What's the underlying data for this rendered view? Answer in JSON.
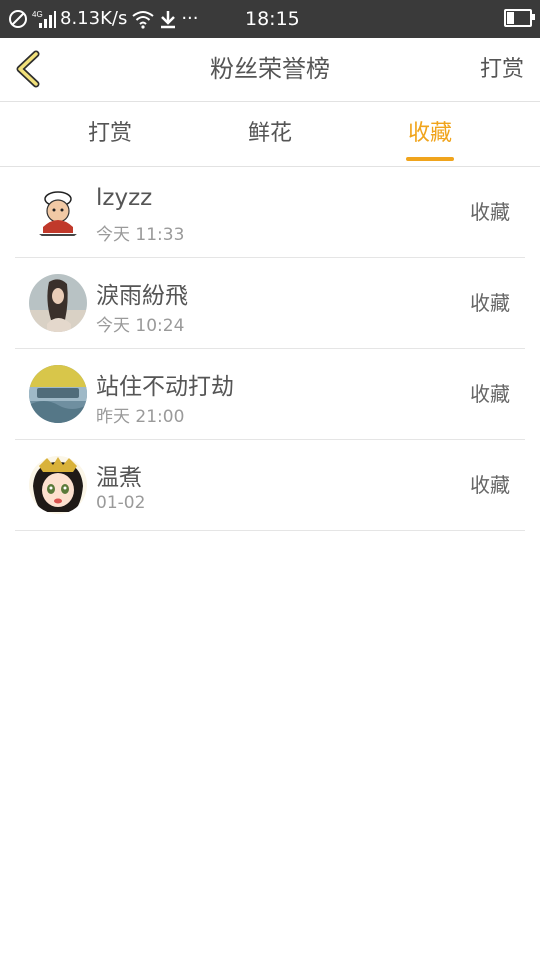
{
  "status_bar": {
    "network_speed": "8.13K/s",
    "network_type": "4G",
    "more": "···",
    "time": "18:15",
    "battery_level": 0.3,
    "icons": [
      "no-disturb-icon",
      "signal-icon",
      "wifi-icon",
      "download-icon",
      "battery-icon"
    ]
  },
  "header": {
    "title": "粉丝荣誉榜",
    "right_action": "打赏",
    "back_icon": "chevron-left-icon"
  },
  "tabs": [
    {
      "label": "打赏",
      "active": false
    },
    {
      "label": "鲜花",
      "active": false
    },
    {
      "label": "收藏",
      "active": true
    }
  ],
  "colors": {
    "accent": "#f0a41c",
    "status_bar": "#3a3a3a",
    "text_primary": "#555555",
    "text_secondary": "#9a9a9a",
    "divider": "#e5e5e5"
  },
  "fans": [
    {
      "name": "lzyzz",
      "time": "今天 11:33",
      "action": "收藏"
    },
    {
      "name": "淚雨紛飛",
      "time": "今天 10:24",
      "action": "收藏"
    },
    {
      "name": "站住不动打劫",
      "time": "昨天 21:00",
      "action": "收藏"
    },
    {
      "name": "温煮",
      "time": "01-02",
      "action": "收藏"
    }
  ]
}
